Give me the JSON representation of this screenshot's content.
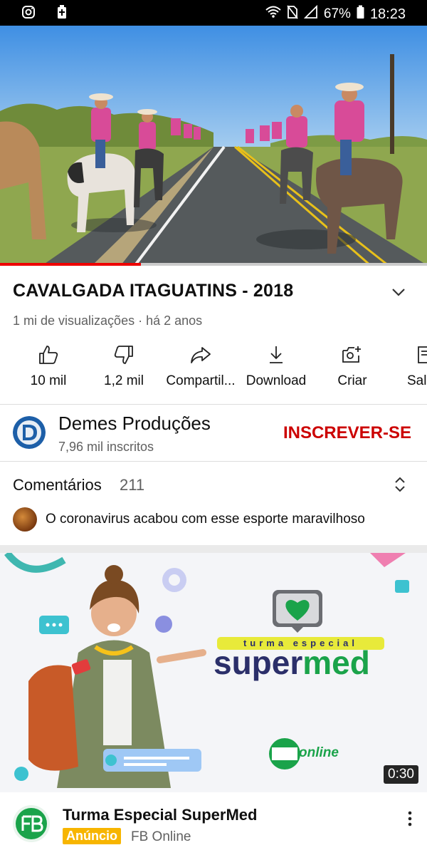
{
  "status_bar": {
    "battery": "67%",
    "time": "18:23"
  },
  "video": {
    "title": "CAVALGADA ITAGUATINS - 2018",
    "views": "1 mi de visualizações",
    "age": "há 2 anos",
    "progress_fraction": 0.33
  },
  "actions": [
    {
      "label": "10 mil",
      "icon": "thumbs-up-icon"
    },
    {
      "label": "1,2 mil",
      "icon": "thumbs-down-icon"
    },
    {
      "label": "Compartil...",
      "icon": "share-icon"
    },
    {
      "label": "Download",
      "icon": "download-icon"
    },
    {
      "label": "Criar",
      "icon": "create-icon"
    },
    {
      "label": "Sal",
      "icon": "save-icon"
    }
  ],
  "channel": {
    "name": "Demes Produções",
    "subscribers": "7,96 mil inscritos",
    "subscribe_label": "INSCREVER-SE"
  },
  "comments": {
    "title": "Comentários",
    "count": "211",
    "top_comment": "O coronavirus acabou com esse esporte maravilhoso"
  },
  "ad": {
    "banner_tagline": "turma especial",
    "banner_brand_1": "super",
    "banner_brand_2": "med",
    "banner_logo_text": "online",
    "duration": "0:30",
    "title": "Turma Especial SuperMed",
    "badge": "Anúncio",
    "channel": "FB Online"
  },
  "colors": {
    "subscribe": "#cc0000",
    "progress": "#ee0000",
    "ad_badge": "#f7b500",
    "brand_green": "#1aa34a"
  }
}
